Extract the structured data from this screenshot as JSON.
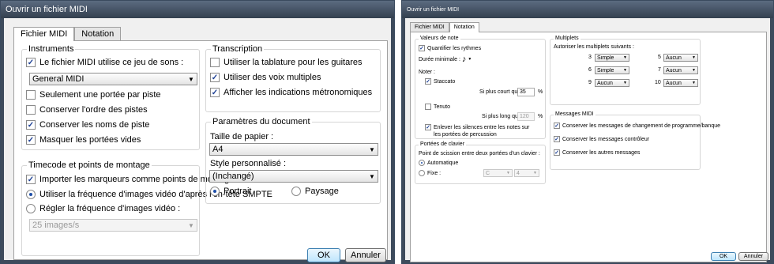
{
  "left": {
    "title": "Ouvrir un fichier MIDI",
    "tabs": [
      "Fichier MIDI",
      "Notation"
    ],
    "instruments": {
      "title": "Instruments",
      "use_soundset": "Le fichier MIDI utilise ce jeu de sons :",
      "soundset_value": "General MIDI",
      "one_staff": "Seulement une portée par piste",
      "keep_order": "Conserver l'ordre des pistes",
      "keep_names": "Conserver les noms de piste",
      "hide_empty": "Masquer les portées vides"
    },
    "timecode": {
      "title": "Timecode et points de montage",
      "import_markers": "Importer les marqueurs comme points de montage",
      "use_smpte": "Utiliser la fréquence d'images vidéo d'après l'en-tête SMPTE",
      "set_rate": "Régler la fréquence d'images vidéo :",
      "rate_value": "25 images/s"
    },
    "transcription": {
      "title": "Transcription",
      "tablature": "Utiliser la tablature pour les guitares",
      "multi_voices": "Utiliser des voix multiples",
      "metronome": "Afficher les indications métronomiques"
    },
    "document": {
      "title": "Paramètres du document",
      "paper_label": "Taille de papier :",
      "paper_value": "A4",
      "style_label": "Style personnalisé :",
      "style_value": "(Inchangé)",
      "portrait": "Portrait",
      "landscape": "Paysage"
    },
    "ok": "OK",
    "cancel": "Annuler"
  },
  "right": {
    "title": "Ouvrir un fichier MIDI",
    "tabs": [
      "Fichier MIDI",
      "Notation"
    ],
    "values": {
      "title": "Valeurs de note",
      "quantize": "Quantifier les rythmes",
      "min_duration": "Durée minimale :",
      "notes_label": "Noter :",
      "staccato": "Staccato",
      "if_shorter": "Si plus court que :",
      "shorter_value": "35",
      "tenuto": "Tenuto",
      "if_longer": "Si plus long que :",
      "longer_value": "120",
      "percent": "%",
      "remove_rests_1": "Enlever les silences entre les notes sur",
      "remove_rests_2": "les portées de percussion"
    },
    "keyboard": {
      "title": "Portées de clavier",
      "split_label": "Point de scission entre deux portées d'un clavier :",
      "automatic": "Automatique",
      "fixed": "Fixe :",
      "note_value": "C",
      "octave_value": "4"
    },
    "tuplets": {
      "title": "Multiplets",
      "allow": "Autoriser les multiplets suivants :",
      "items": [
        {
          "n": "3",
          "value": "Simple"
        },
        {
          "n": "5",
          "value": "Aucun"
        },
        {
          "n": "6",
          "value": "Simple"
        },
        {
          "n": "7",
          "value": "Aucun"
        },
        {
          "n": "9",
          "value": "Aucun"
        },
        {
          "n": "10",
          "value": "Aucun"
        }
      ]
    },
    "midi": {
      "title": "Messages MIDI",
      "keep_program": "Conserver les messages de changement de programme/banque",
      "keep_controller": "Conserver les messages contrôleur",
      "keep_other": "Conserver les autres messages"
    },
    "ok": "OK",
    "cancel": "Annuler"
  }
}
